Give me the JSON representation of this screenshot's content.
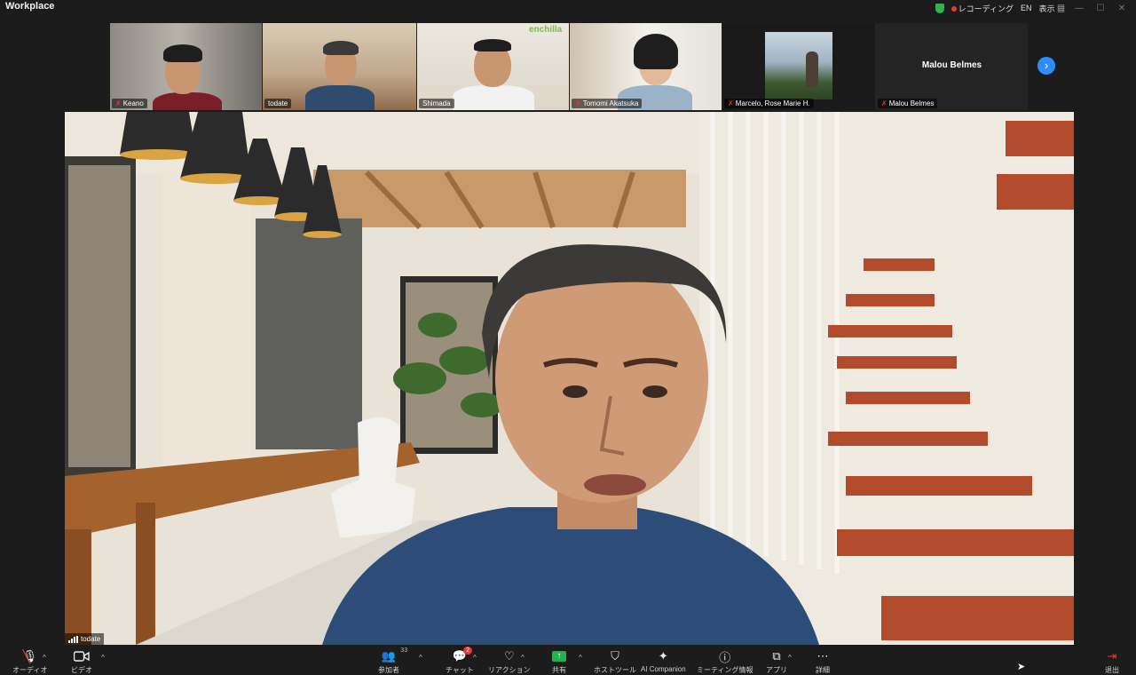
{
  "app": {
    "title": "Workplace"
  },
  "titlebar": {
    "recording": "レコーディング",
    "lang": "EN",
    "view": "表示"
  },
  "gallery": {
    "tiles": [
      {
        "name": "Keano",
        "muted": true
      },
      {
        "name": "todate",
        "muted": false,
        "active": true
      },
      {
        "name": "Shimada",
        "muted": false
      },
      {
        "name": "Tomomi Akatsuka",
        "muted": true
      },
      {
        "name": "Marcelo, Rose Marie H.",
        "muted": true
      },
      {
        "name": "Malou Belmes",
        "muted": true,
        "center_label": "Malou Belmes"
      }
    ],
    "logo_text": "enchilla"
  },
  "main_video": {
    "speaker": "todate"
  },
  "toolbar": {
    "audio": "オーディオ",
    "video": "ビデオ",
    "participants": "参加者",
    "participants_count": "33",
    "chat": "チャット",
    "chat_badge": "2",
    "reactions": "リアクション",
    "share": "共有",
    "host_tools": "ホストツール",
    "ai_companion": "AI Companion",
    "meeting_info": "ミーティング情報",
    "apps": "アプリ",
    "more": "詳細",
    "leave": "退出"
  },
  "colors": {
    "accent": "#2d8cff",
    "active_outline": "#2ecc71",
    "muted": "#e53935",
    "share": "#22b14c"
  }
}
